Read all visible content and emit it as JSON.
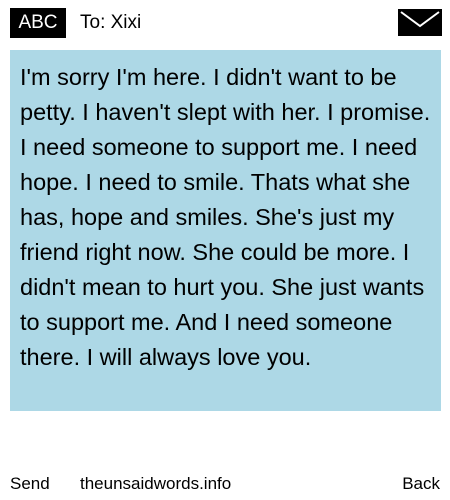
{
  "header": {
    "input_mode": "ABC",
    "to_label": "To: Xixi",
    "message_icon": "envelope-icon"
  },
  "message": {
    "body": "I'm sorry I'm here. I didn't want to be petty. I haven't slept with her. I promise. I need someone to support me. I need hope. I need to smile. Thats what she has, hope and smiles. She's just my friend right now. She could be more. I didn't mean to hurt you. She just wants to support me. And I need someone there. I will always love you."
  },
  "footer": {
    "send_label": "Send",
    "site_label": "theunsaidwords.info",
    "back_label": "Back"
  },
  "colors": {
    "message_background": "#add8e6",
    "badge_background": "#000000",
    "page_background": "#ffffff"
  }
}
